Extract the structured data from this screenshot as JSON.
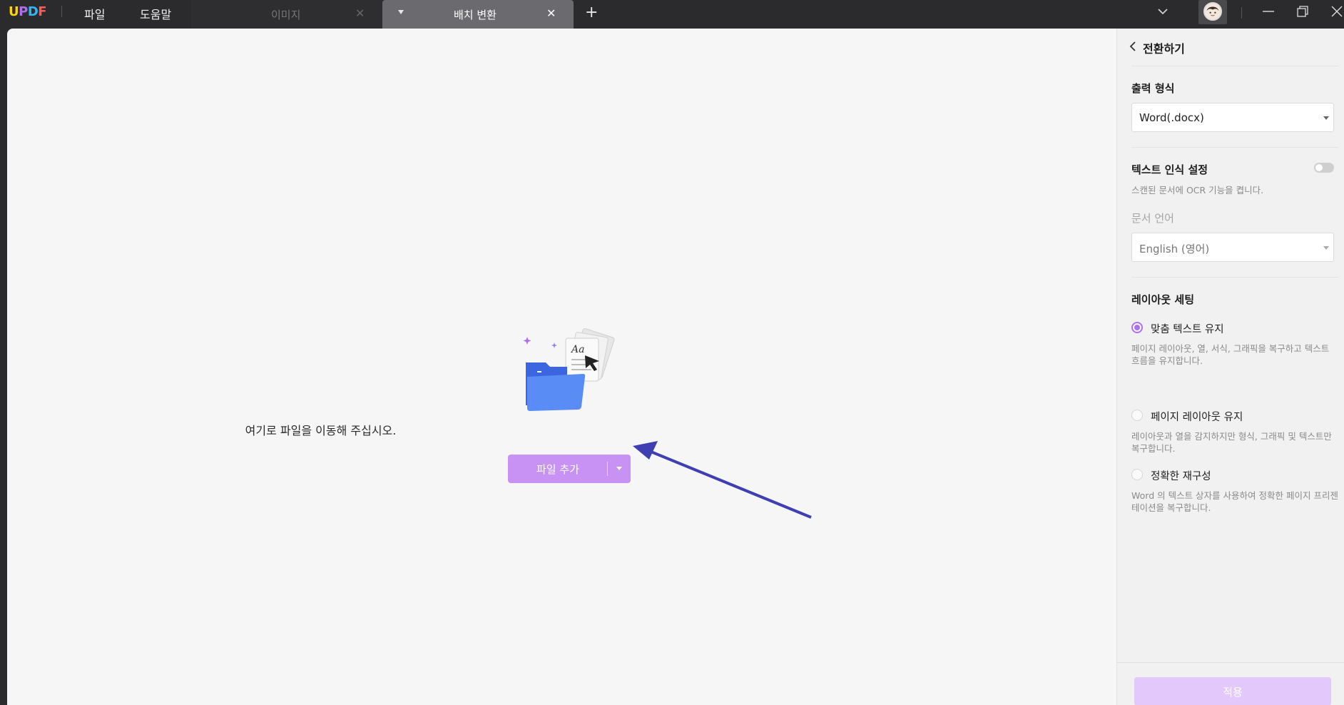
{
  "app": {
    "logo_letters": [
      "U",
      "P",
      "D",
      "F"
    ],
    "logo_colors": [
      "#ffd400",
      "#b16cf2",
      "#2fb6f5",
      "#ff5a5a"
    ]
  },
  "menu": {
    "file": "파일",
    "help": "도움말"
  },
  "tabs": [
    {
      "label": "이미지",
      "active": false
    },
    {
      "label": "배치 변환",
      "active": true
    }
  ],
  "main": {
    "drop_text": "여기로 파일을 이동해 주십시오.",
    "add_file_label": "파일 추가"
  },
  "panel": {
    "back_title": "전환하기",
    "output_format_title": "출력 형식",
    "output_format_value": "Word(.docx)",
    "ocr_title": "텍스트 인식 설정",
    "ocr_enabled": false,
    "ocr_hint": "스캔된 문서에 OCR 기능을 켭니다.",
    "doc_lang_title": "문서 언어",
    "doc_lang_value": "English (영어)",
    "layout_title": "레이아웃 세팅",
    "layout_options": [
      {
        "label": "맞춤 텍스트 유지",
        "desc": "페이지 레이아웃, 열, 서식, 그래픽을 복구하고 텍스트 흐름을 유지합니다.",
        "selected": true
      },
      {
        "label": "페이지 레이아웃 유지",
        "desc": "레이아웃과 열을 감지하지만 형식, 그래픽 및 텍스트만 복구합니다.",
        "selected": false
      },
      {
        "label": "정확한 재구성",
        "desc": "Word 의 텍스트 상자를 사용하여 정확한 페이지 프리젠테이션을 복구합니다.",
        "selected": false
      }
    ],
    "apply_label": "적용"
  },
  "colors": {
    "accent": "#b06ff0",
    "add_button": "#c792f4",
    "apply_button_disabled": "#e3c9fb",
    "annotation_arrow": "#3f3fb3"
  },
  "icons": {
    "tab_close": "close-icon",
    "new_tab": "plus-icon",
    "tabs_menu": "chevron-down-icon",
    "minimize": "minimize-icon",
    "restore": "restore-icon",
    "close": "close-icon",
    "back": "chevron-left-icon",
    "drop": "folder-documents-icon"
  }
}
